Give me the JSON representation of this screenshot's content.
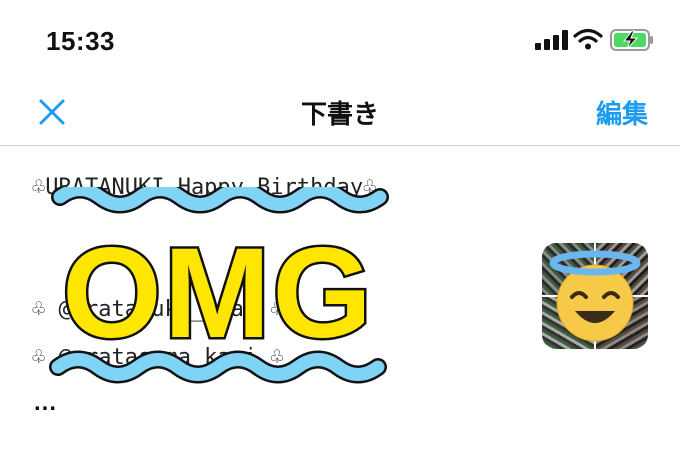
{
  "status_bar": {
    "time": "15:33"
  },
  "nav": {
    "title": "下書き",
    "edit_label": "編集"
  },
  "draft": {
    "line1": "♧URATANUKI_Happy Birthday♧",
    "line2": "♧ @uratanuki_chan ♧",
    "line3": "♧ @uratasama_kari ♧",
    "ellipsis": "...",
    "sticker_text": "OMG"
  },
  "colors": {
    "accent": "#1d9bf0",
    "sticker_yellow": "#ffe600",
    "wave_blue": "#7fd3f5",
    "battery_green": "#4cd964"
  },
  "icons": {
    "close": "close-icon",
    "signal": "signal-icon",
    "wifi": "wifi-icon",
    "battery": "battery-charging-icon"
  }
}
